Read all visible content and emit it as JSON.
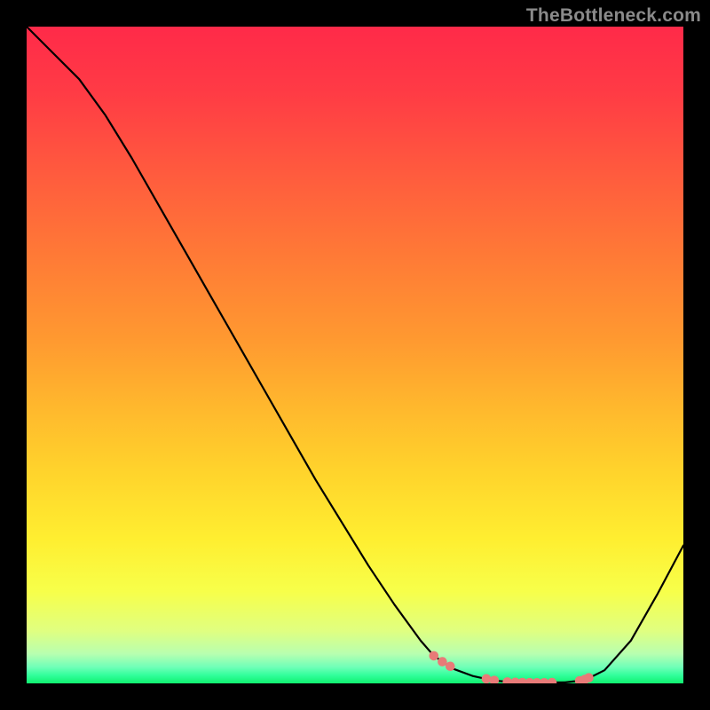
{
  "watermark": "TheBottleneck.com",
  "chart_data": {
    "type": "line",
    "title": "",
    "xlabel": "",
    "ylabel": "",
    "xlim": [
      0,
      100
    ],
    "ylim": [
      0,
      100
    ],
    "grid": false,
    "gradient_stops": [
      {
        "offset": 0.0,
        "color": "#ff2a49"
      },
      {
        "offset": 0.1,
        "color": "#ff3b45"
      },
      {
        "offset": 0.22,
        "color": "#ff5a3e"
      },
      {
        "offset": 0.35,
        "color": "#ff7a36"
      },
      {
        "offset": 0.48,
        "color": "#ff9a30"
      },
      {
        "offset": 0.58,
        "color": "#ffb82d"
      },
      {
        "offset": 0.68,
        "color": "#ffd42c"
      },
      {
        "offset": 0.78,
        "color": "#ffee30"
      },
      {
        "offset": 0.86,
        "color": "#f7ff4a"
      },
      {
        "offset": 0.92,
        "color": "#e0ff80"
      },
      {
        "offset": 0.955,
        "color": "#b8ffb0"
      },
      {
        "offset": 0.975,
        "color": "#70ffb8"
      },
      {
        "offset": 0.988,
        "color": "#30ff9a"
      },
      {
        "offset": 1.0,
        "color": "#10f070"
      }
    ],
    "series": [
      {
        "name": "bottleneck-curve",
        "x": [
          0,
          4,
          8,
          12,
          16,
          20,
          24,
          28,
          32,
          36,
          40,
          44,
          48,
          52,
          56,
          60,
          62,
          65,
          68,
          71,
          74,
          77,
          82,
          85,
          88,
          92,
          96,
          100
        ],
        "y": [
          100,
          96,
          92,
          86.5,
          80,
          73,
          66,
          59,
          52,
          45,
          38,
          31,
          24.5,
          18,
          12,
          6.5,
          4.2,
          2.2,
          1.1,
          0.45,
          0.18,
          0.1,
          0.15,
          0.5,
          2.0,
          6.5,
          13.5,
          21
        ]
      }
    ],
    "markers": {
      "name": "optimal-zone",
      "color": "#e87b78",
      "points": [
        {
          "x": 62,
          "y": 4.2
        },
        {
          "x": 63.3,
          "y": 3.3
        },
        {
          "x": 64.5,
          "y": 2.6
        },
        {
          "x": 70,
          "y": 0.7
        },
        {
          "x": 71.2,
          "y": 0.45
        },
        {
          "x": 73.2,
          "y": 0.22
        },
        {
          "x": 74.4,
          "y": 0.17
        },
        {
          "x": 75.5,
          "y": 0.13
        },
        {
          "x": 76.6,
          "y": 0.11
        },
        {
          "x": 77.7,
          "y": 0.1
        },
        {
          "x": 78.8,
          "y": 0.1
        },
        {
          "x": 80.0,
          "y": 0.12
        },
        {
          "x": 84.2,
          "y": 0.4
        },
        {
          "x": 85.0,
          "y": 0.6
        },
        {
          "x": 85.6,
          "y": 0.85
        }
      ]
    }
  }
}
